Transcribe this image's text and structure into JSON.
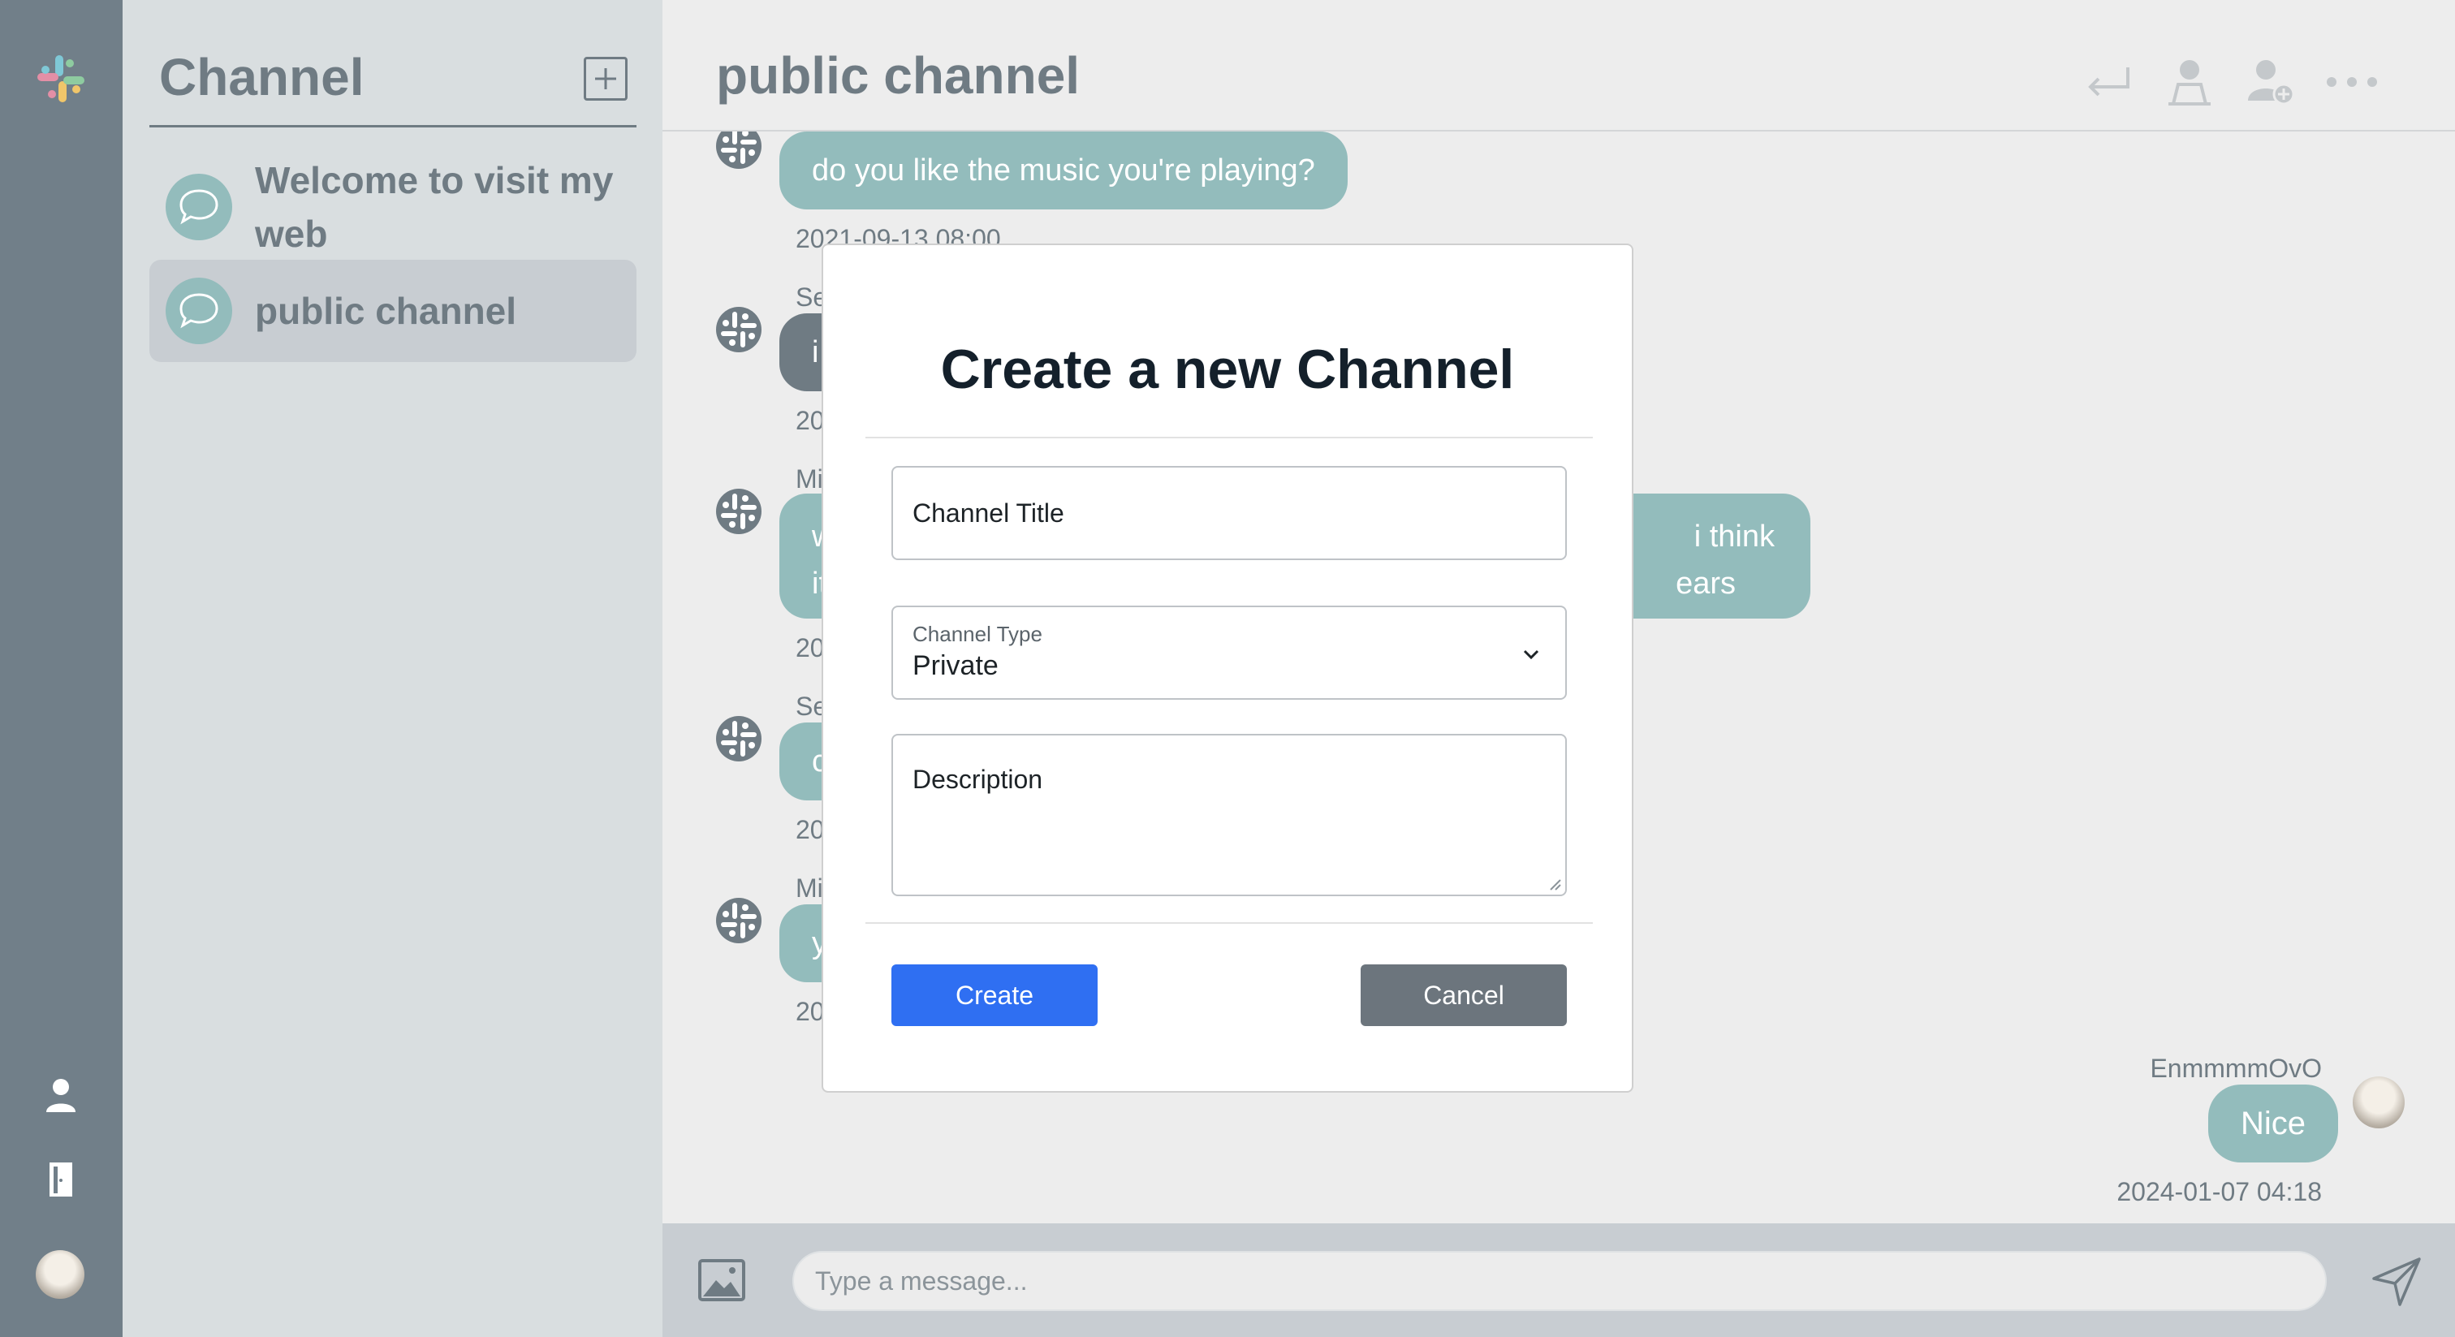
{
  "sidebar": {
    "title": "Channel",
    "channels": [
      {
        "label": "Welcome to visit my web"
      },
      {
        "label": "public channel"
      }
    ]
  },
  "header": {
    "title": "public channel",
    "icons": [
      "return-icon",
      "user-profile-icon",
      "add-user-icon",
      "more-icon"
    ]
  },
  "messages": [
    {
      "sender": "",
      "text": "do you like the music you're playing?",
      "time": "2021-09-13 08:00"
    },
    {
      "sender": "Se",
      "text": "i",
      "time": "20"
    },
    {
      "sender": "Mi",
      "text_start": "w",
      "text_start2": "it",
      "text_end": "i think",
      "text_end2": "ears",
      "time": "20"
    },
    {
      "sender": "Se",
      "text": "c",
      "time": "20"
    },
    {
      "sender": "Mi",
      "text": "y",
      "time": "20"
    }
  ],
  "own_message": {
    "sender": "EnmmmmOvO",
    "text": "Nice",
    "time": "2024-01-07 04:18"
  },
  "composer": {
    "placeholder": "Type a message..."
  },
  "modal": {
    "title": "Create a new Channel",
    "title_placeholder": "Channel Title",
    "type_label": "Channel Type",
    "type_value": "Private",
    "description_placeholder": "Description",
    "create_label": "Create",
    "cancel_label": "Cancel"
  },
  "colors": {
    "rail": "#717f89",
    "sidebar": "#d9dee0",
    "bubble": "#93bcbc",
    "primary_button": "#2f6ff2",
    "secondary_button": "#6c757d"
  }
}
